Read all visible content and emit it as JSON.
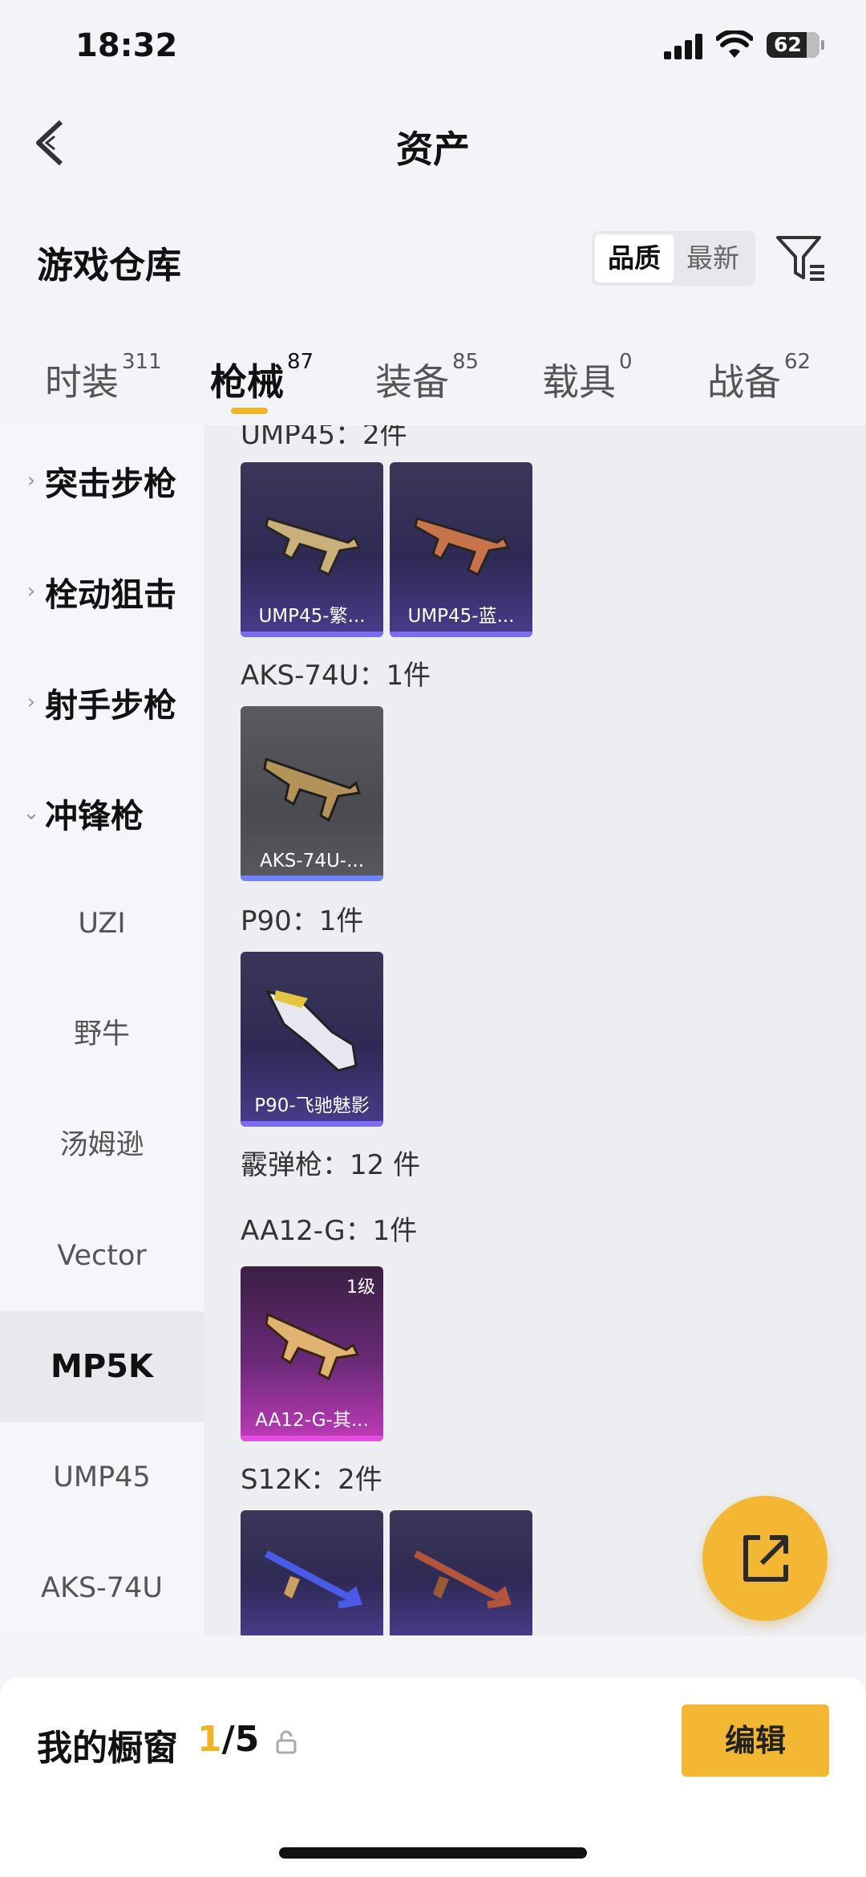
{
  "status": {
    "time": "18:32",
    "battery": "62"
  },
  "header": {
    "title": "资产"
  },
  "warehouse": {
    "title": "游戏仓库",
    "sort": [
      "品质",
      "最新"
    ]
  },
  "tabs": [
    {
      "label": "时装",
      "count": "311"
    },
    {
      "label": "枪械",
      "count": "87"
    },
    {
      "label": "装备",
      "count": "85"
    },
    {
      "label": "载具",
      "count": "0"
    },
    {
      "label": "战备",
      "count": "62"
    }
  ],
  "sidebar": {
    "categories": [
      "突击步枪",
      "栓动狙击",
      "射手步枪",
      "冲锋枪"
    ],
    "subs": [
      "UZI",
      "野牛",
      "汤姆逊",
      "Vector",
      "MP5K",
      "UMP45",
      "AKS-74U"
    ]
  },
  "content": {
    "groups": [
      {
        "title": "UMP45：2件",
        "items": [
          "UMP45-繁...",
          "UMP45-蓝..."
        ]
      },
      {
        "title": "AKS-74U：1件",
        "items": [
          "AKS-74U-..."
        ]
      },
      {
        "title": "P90：1件",
        "items": [
          "P90-飞驰魅影"
        ]
      },
      {
        "title": "霰弹枪：12 件"
      },
      {
        "title": "AA12-G：1件",
        "items": [
          "AA12-G-其..."
        ],
        "level": "1级"
      },
      {
        "title": "S12K：2件"
      }
    ]
  },
  "bottom": {
    "title": "我的橱窗",
    "current": "1",
    "total": "/5",
    "edit": "编辑"
  },
  "icons": [
    "back-icon",
    "filter-icon",
    "chevron-right-icon",
    "chevron-down-icon",
    "share-icon",
    "lock-icon",
    "signal-icon",
    "wifi-icon",
    "battery-icon"
  ]
}
